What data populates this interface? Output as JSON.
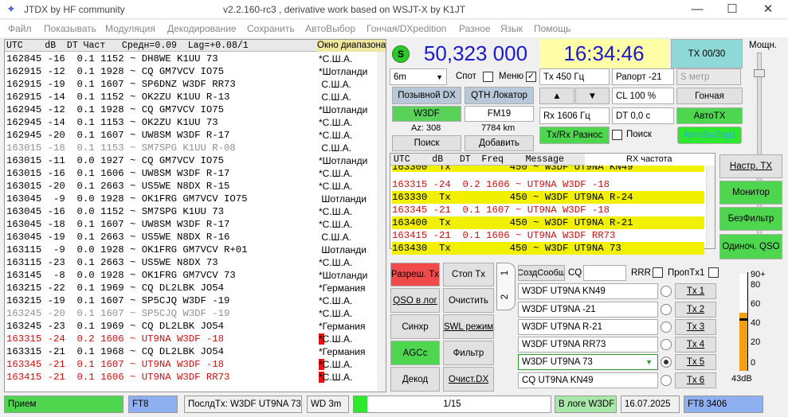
{
  "window": {
    "app_title": "JTDX  by HF community",
    "version_text": "v2.2.160-rc3 , derivative work based on WSJT-X by K1JT",
    "minimize": "—",
    "maximize": "☐",
    "close": "✕"
  },
  "menu": [
    "Файл",
    "Показывать",
    "Модуляция",
    "Декодирование",
    "Сохранить",
    "АвтоВыбор",
    "Гончая/DXpedition",
    "Разное",
    "Язык",
    "Помощь"
  ],
  "decode_header": "UTC    dB  DT Част   Средн=0.09  Lag=+0.08/1",
  "band_activity_label": "Окно диапазона",
  "decodes": [
    {
      "t": "162845 -16  0.1 1152 ~ DH8WE K1UU 73",
      "c": "*С.Ш.А.",
      "style": "normal"
    },
    {
      "t": "162915 -12  0.1 1928 ~ CQ GM7VCV IO75",
      "c": "*Шотланди",
      "style": "normal"
    },
    {
      "t": "162915 -19  0.1 1607 ~ SP6DNZ W3DF RR73",
      "c": " С.Ш.А.",
      "style": "normal"
    },
    {
      "t": "162915 -14  0.1 1152 ~ OK2ZU K1UU R-13",
      "c": " С.Ш.А.",
      "style": "normal"
    },
    {
      "t": "162945 -12  0.1 1928 ~ CQ GM7VCV IO75",
      "c": "*Шотланди",
      "style": "normal"
    },
    {
      "t": "162945 -14  0.1 1153 ~ OK2ZU K1UU 73",
      "c": "*С.Ш.А.",
      "style": "normal"
    },
    {
      "t": "162945 -20  0.1 1607 ~ UW8SM W3DF R-17",
      "c": "*С.Ш.А.",
      "style": "normal"
    },
    {
      "t": "163015 -18  0.1 1153 ~ SM7SPG K1UU R-08",
      "c": " С.Ш.А.",
      "style": "gray"
    },
    {
      "t": "163015 -11  0.0 1927 ~ CQ GM7VCV IO75",
      "c": "*Шотланди",
      "style": "normal"
    },
    {
      "t": "163015 -16  0.1 1606 ~ UW8SM W3DF R-17",
      "c": "*С.Ш.А.",
      "style": "normal"
    },
    {
      "t": "163015 -20  0.1 2663 ~ US5WE N8DX R-15",
      "c": "*С.Ш.А.",
      "style": "normal"
    },
    {
      "t": "163045  -9  0.0 1928 ~ OK1FRG GM7VCV IO75",
      "c": " Шотланди",
      "style": "normal"
    },
    {
      "t": "163045 -16  0.0 1152 ~ SM7SPG K1UU 73",
      "c": "*С.Ш.А.",
      "style": "normal"
    },
    {
      "t": "163045 -18  0.1 1607 ~ UW8SM W3DF R-17",
      "c": "*С.Ш.А.",
      "style": "normal"
    },
    {
      "t": "163045 -19  0.1 2663 ~ US5WE N8DX R-16",
      "c": " С.Ш.А.",
      "style": "normal"
    },
    {
      "t": "163115  -9  0.0 1928 ~ OK1FRG GM7VCV R+01",
      "c": " Шотланди",
      "style": "normal"
    },
    {
      "t": "163115 -23  0.1 2663 ~ US5WE N8DX 73",
      "c": "*С.Ш.А.",
      "style": "normal"
    },
    {
      "t": "163145  -8  0.0 1928 ~ OK1FRG GM7VCV 73",
      "c": "*Шотланди",
      "style": "normal"
    },
    {
      "t": "163215 -22  0.1 1969 ~ CQ DL2LBK JO54",
      "c": "*Германия",
      "style": "normal"
    },
    {
      "t": "163215 -19  0.1 1607 ~ SP5CJQ W3DF -19",
      "c": "*С.Ш.А.",
      "style": "normal"
    },
    {
      "t": "163245 -20  0.1 1607 ~ SP5CJQ W3DF -19",
      "c": "*С.Ш.А.",
      "style": "gray"
    },
    {
      "t": "163245 -23  0.1 1969 ~ CQ DL2LBK JO54",
      "c": "*Германия",
      "style": "normal"
    },
    {
      "t": "163315 -24  0.2 1606 ~ UT9NA W3DF -18",
      "c": "*С.Ш.А.",
      "style": "red"
    },
    {
      "t": "163315 -21  0.1 1968 ~ CQ DL2LBK JO54",
      "c": "*Германия",
      "style": "normal"
    },
    {
      "t": "163345 -21  0.1 1607 ~ UT9NA W3DF -18",
      "c": "*С.Ш.А.",
      "style": "red"
    },
    {
      "t": "163415 -21  0.1 1606 ~ UT9NA W3DF RR73",
      "c": "*С.Ш.А.",
      "style": "red"
    }
  ],
  "radio": {
    "s_label": "S",
    "frequency": "50,323 000",
    "time": "16:34:46",
    "tx_counter": "TX 00/30",
    "power_label": "Мощн.",
    "band": "6m",
    "spot_label": "Спот",
    "menu_label": "Меню",
    "tx_freq": "Tx  450  Гц",
    "report": "Рапорт -21",
    "s_meter": "S метр",
    "dx_call_btn": "Позывной DX",
    "dx_grid_btn": "QTH Локатор",
    "dx_call": "W3DF",
    "dx_grid": "FM19",
    "az": "Az: 308",
    "dist": "7784 km",
    "lookup": "Поиск",
    "add": "Добавить",
    "cl": "CL  100 %",
    "hound": "Гончая",
    "rx_freq": "Rx  1606  Гц",
    "dt": "DT 0,0 с",
    "auto_tx": "АвтоТХ",
    "txrx_split": "Tx/Rx Разнос",
    "search_label": "Поиск",
    "auto_select": "АвтоВыбор1"
  },
  "rx_header": "UTC    dB   DT  Freq    Message",
  "rx_freq_label": "RX частота",
  "rx_lines": [
    {
      "t": "163300  Tx          450 ~ W3DF UT9NA KN49",
      "s": "tx"
    },
    {
      "t": "163315 -24  0.2 1606 ~ UT9NA W3DF -18",
      "s": "red"
    },
    {
      "t": "163330  Tx          450 ~ W3DF UT9NA R-24",
      "s": "tx"
    },
    {
      "t": "163345 -21  0.1 1607 ~ UT9NA W3DF -18",
      "s": "red"
    },
    {
      "t": "163400  Tx          450 ~ W3DF UT9NA R-21",
      "s": "tx"
    },
    {
      "t": "163415 -21  0.1 1606 ~ UT9NA W3DF RR73",
      "s": "red"
    },
    {
      "t": "163430  Tx          450 ~ W3DF UT9NA 73",
      "s": "tx"
    }
  ],
  "right_buttons": {
    "tune": "Настр. TX",
    "monitor": "Монитор",
    "no_filter": "БезФильтр",
    "single_qso": "Одиноч. QSO"
  },
  "left_buttons": {
    "enable_tx": "Разреш. Tx",
    "stop_tx": "Стоп Tx",
    "log_qso": "QSO в лог",
    "erase": "Очистить",
    "sync": "Синхр",
    "swl": "SWL режим",
    "agc": "AGCc",
    "filter": "Фильтр",
    "decode": "Декод",
    "clear_dx": "Очист.DX"
  },
  "tx_panel": {
    "tab1": "1",
    "tab2": "2",
    "gen_msgs": "СоздСообщ",
    "cq_label": "CQ",
    "rrr_label": "RRR",
    "skip_tx1": "ПропTx1",
    "messages": [
      "W3DF UT9NA KN49",
      "W3DF UT9NA -21",
      "W3DF UT9NA R-21",
      "W3DF UT9NA RR73",
      "W3DF UT9NA 73",
      "CQ UT9NA KN49"
    ],
    "tx_buttons": [
      "Tx 1",
      "Tx 2",
      "Tx 3",
      "Tx 4",
      "Tx 5",
      "Tx 6"
    ]
  },
  "meter": {
    "ticks": [
      "90+",
      "80",
      "60",
      "40",
      "20",
      "0"
    ],
    "level_db": "43dB",
    "level_fraction": 0.43
  },
  "status": {
    "rx": "Прием",
    "mode": "FT8",
    "last_tx": "ПослдTx: W3DF UT9NA 73",
    "wd": "WD 3m",
    "progress": "1/15",
    "progress_fraction": 0.07,
    "logged": "В логе W3DF",
    "date": "16.07.2025",
    "mode2": "FT8  3406"
  },
  "colors": {
    "green": "#4ed64e",
    "red_text": "#d01010",
    "tx_yellow": "#f0f000",
    "freq_blue": "#1a1ac8",
    "mode_blue": "#8fb0f0"
  }
}
